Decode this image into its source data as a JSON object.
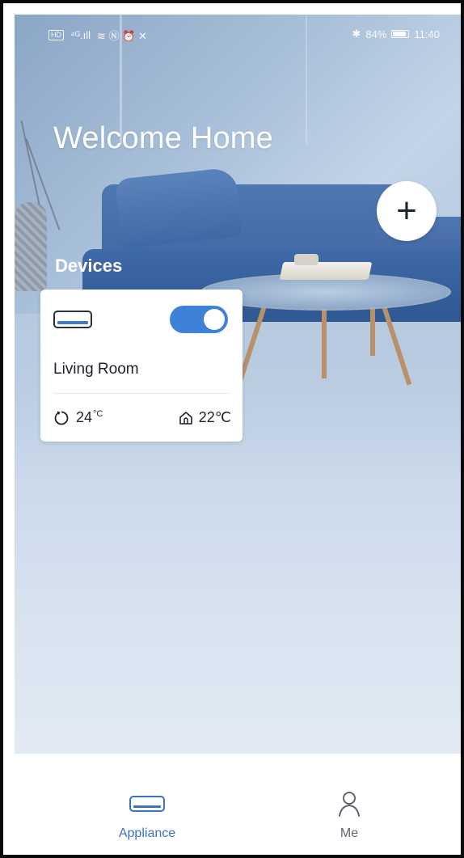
{
  "status_bar": {
    "left_badge": "HD",
    "left_signal": "⁴ᴳ.ıll",
    "left_icons": "≋ Ⓝ ⏰ ✕",
    "bluetooth": "✱",
    "battery_text": "84%",
    "time": "11:40"
  },
  "header": {
    "welcome_title": "Welcome Home",
    "add_glyph": "+"
  },
  "devices": {
    "section_label": "Devices",
    "items": [
      {
        "name": "Living Room",
        "power_on": true,
        "set_temp": "24",
        "set_temp_unit": "°C",
        "room_temp": "22",
        "room_temp_unit": "℃"
      }
    ]
  },
  "bottom_nav": {
    "items": [
      {
        "label": "Appliance",
        "icon": "air-conditioner-icon",
        "active": true
      },
      {
        "label": "Me",
        "icon": "person-icon",
        "active": false
      }
    ]
  },
  "colors": {
    "accent": "#3a72c4",
    "toggle_on": "#3d82d8",
    "sofa": "#3d66a3"
  }
}
